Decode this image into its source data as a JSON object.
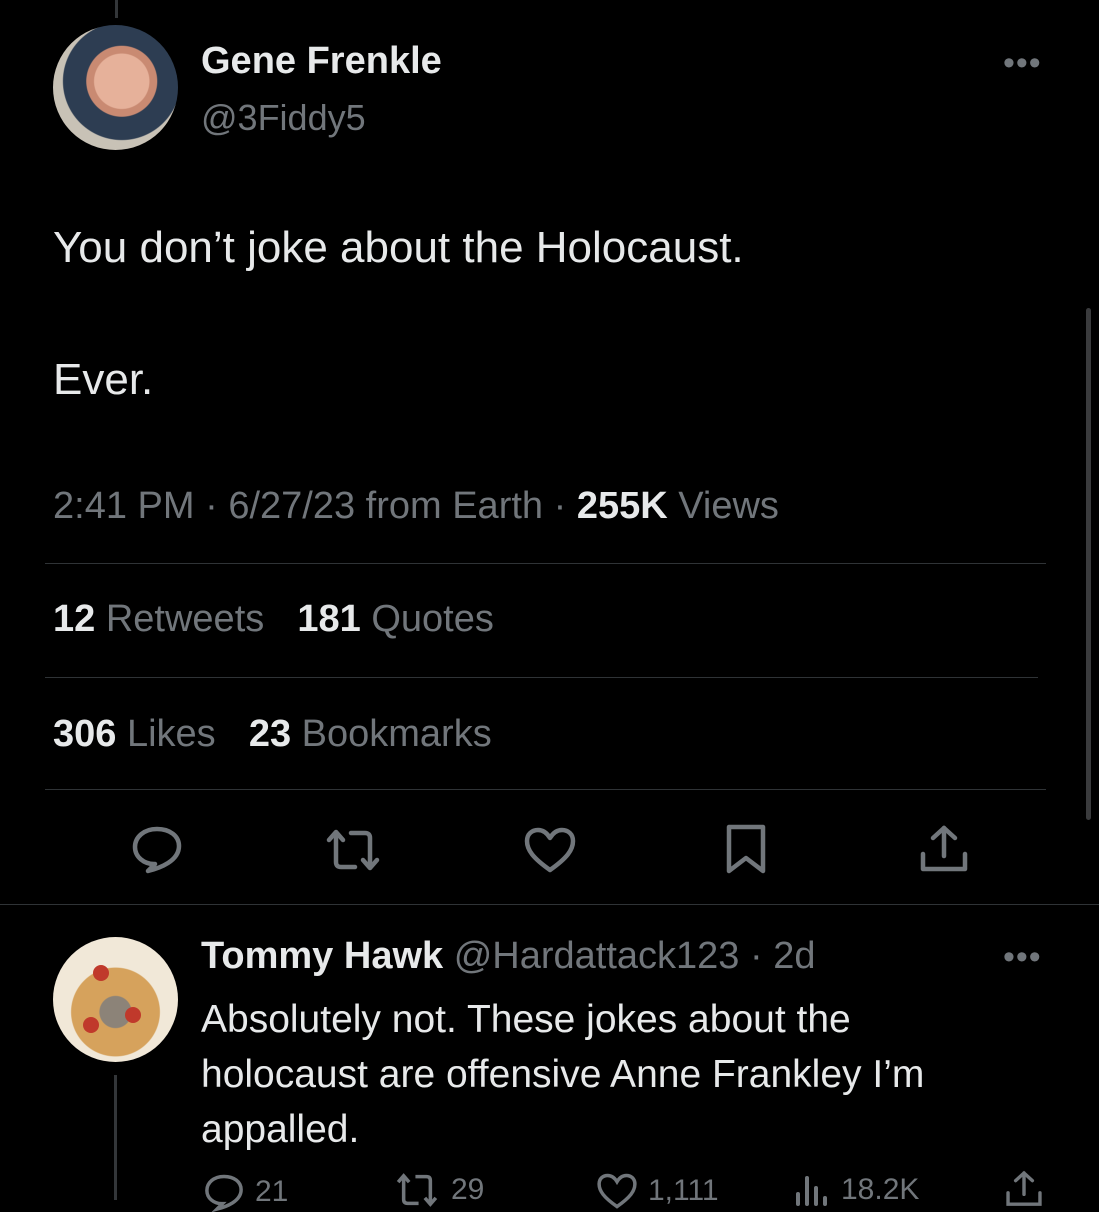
{
  "tweet": {
    "author_name": "Gene Frenkle",
    "author_handle": "@3Fiddy5",
    "text_line1": "You don’t joke about the Holocaust.",
    "text_line2": "Ever.",
    "time": "2:41 PM",
    "sep1": "·",
    "date": "6/27/23 from Earth",
    "sep2": "·",
    "views_count": "255K",
    "views_label": "Views",
    "retweets_count": "12",
    "retweets_label": "Retweets",
    "quotes_count": "181",
    "quotes_label": "Quotes",
    "likes_count": "306",
    "likes_label": "Likes",
    "bookmarks_count": "23",
    "bookmarks_label": "Bookmarks",
    "more": "•••"
  },
  "reply": {
    "author_name": "Tommy Hawk",
    "author_handle": "@Hardattack123",
    "sep": "·",
    "age": "2d",
    "text_line1": "Absolutely not. These jokes about the",
    "text_line2": "holocaust are offensive Anne Frankley I’m",
    "text_line3": "appalled.",
    "replies": "21",
    "retweets": "29",
    "likes": "1,111",
    "views": "18.2K",
    "more": "•••"
  },
  "icons": {
    "reply": "speech-bubble",
    "retweet": "retweet-arrows",
    "like": "heart",
    "bookmark": "bookmark",
    "share": "share-upload",
    "views": "bar-chart",
    "more": "ellipsis"
  },
  "colors": {
    "background": "#000000",
    "text": "#e7e9ea",
    "muted": "#71767b",
    "divider": "#2f3336"
  }
}
